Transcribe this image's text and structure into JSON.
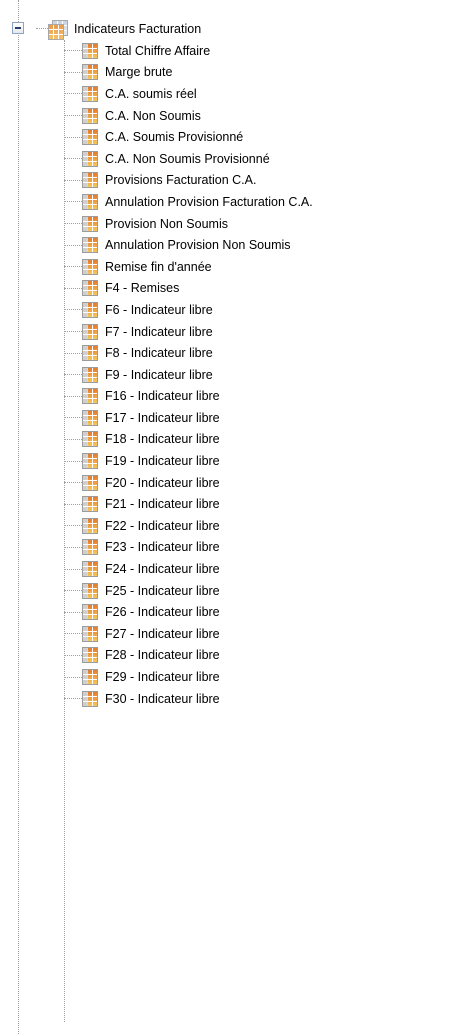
{
  "tree": {
    "root": {
      "label": "Indicateurs Facturation",
      "icon": "table-folder-icon",
      "expanded": true
    },
    "children": [
      {
        "label": "Total Chiffre Affaire",
        "icon": "table-icon"
      },
      {
        "label": "Marge brute",
        "icon": "table-icon"
      },
      {
        "label": "C.A. soumis réel",
        "icon": "table-icon"
      },
      {
        "label": "C.A. Non Soumis",
        "icon": "table-icon"
      },
      {
        "label": "C.A. Soumis Provisionné",
        "icon": "table-icon"
      },
      {
        "label": "C.A. Non Soumis Provisionné",
        "icon": "table-icon"
      },
      {
        "label": "Provisions Facturation C.A.",
        "icon": "table-icon"
      },
      {
        "label": "Annulation Provision Facturation C.A.",
        "icon": "table-icon"
      },
      {
        "label": "Provision Non Soumis",
        "icon": "table-icon"
      },
      {
        "label": "Annulation Provision Non Soumis",
        "icon": "table-icon"
      },
      {
        "label": "Remise fin d'année",
        "icon": "table-icon"
      },
      {
        "label": "F4 - Remises",
        "icon": "table-icon"
      },
      {
        "label": "F6 - Indicateur libre",
        "icon": "table-icon"
      },
      {
        "label": "F7 - Indicateur libre",
        "icon": "table-icon"
      },
      {
        "label": "F8 - Indicateur libre",
        "icon": "table-icon"
      },
      {
        "label": "F9 - Indicateur libre",
        "icon": "table-icon"
      },
      {
        "label": "F16 - Indicateur libre",
        "icon": "table-icon"
      },
      {
        "label": "F17 - Indicateur libre",
        "icon": "table-icon"
      },
      {
        "label": "F18 - Indicateur libre",
        "icon": "table-icon"
      },
      {
        "label": "F19 - Indicateur libre",
        "icon": "table-icon"
      },
      {
        "label": "F20 - Indicateur libre",
        "icon": "table-icon"
      },
      {
        "label": "F21 - Indicateur libre",
        "icon": "table-icon"
      },
      {
        "label": "F22 - Indicateur libre",
        "icon": "table-icon"
      },
      {
        "label": "F23 - Indicateur libre",
        "icon": "table-icon"
      },
      {
        "label": "F24 - Indicateur libre",
        "icon": "table-icon"
      },
      {
        "label": "F25 - Indicateur libre",
        "icon": "table-icon"
      },
      {
        "label": "F26 - Indicateur libre",
        "icon": "table-icon"
      },
      {
        "label": "F27 - Indicateur libre",
        "icon": "table-icon"
      },
      {
        "label": "F28 - Indicateur libre",
        "icon": "table-icon"
      },
      {
        "label": "F29 - Indicateur libre",
        "icon": "table-icon"
      },
      {
        "label": "F30 - Indicateur libre",
        "icon": "table-icon"
      }
    ]
  },
  "colors": {
    "connector": "#a0a0a0",
    "icon_orange": "#e57a2e",
    "icon_yellow": "#f6c75a"
  }
}
